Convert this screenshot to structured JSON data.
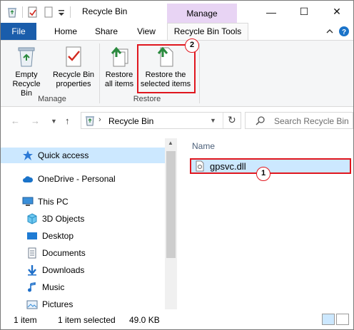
{
  "window": {
    "title": "Recycle Bin",
    "context_tab_group": "Manage",
    "minimize_glyph": "—",
    "maximize_glyph": "☐",
    "close_glyph": "✕"
  },
  "tabs": {
    "file": "File",
    "home": "Home",
    "share": "Share",
    "view": "View",
    "recycle_bin_tools": "Recycle Bin Tools"
  },
  "ribbon": {
    "empty_recycle_bin": "Empty\nRecycle Bin",
    "recycle_bin_properties": "Recycle Bin\nproperties",
    "manage_group": "Manage",
    "restore_all_items": "Restore\nall items",
    "restore_selected_items": "Restore the\nselected items",
    "restore_group": "Restore"
  },
  "navigation": {
    "address_path": "Recycle Bin",
    "search_placeholder": "Search Recycle Bin"
  },
  "nav_pane": {
    "items": [
      {
        "label": "Quick access",
        "icon": "star-icon"
      },
      {
        "label": "OneDrive - Personal",
        "icon": "cloud-icon"
      },
      {
        "label": "This PC",
        "icon": "pc-icon"
      },
      {
        "label": "3D Objects",
        "icon": "cube-icon"
      },
      {
        "label": "Desktop",
        "icon": "desktop-icon"
      },
      {
        "label": "Documents",
        "icon": "documents-icon"
      },
      {
        "label": "Downloads",
        "icon": "downloads-icon"
      },
      {
        "label": "Music",
        "icon": "music-icon"
      },
      {
        "label": "Pictures",
        "icon": "pictures-icon"
      }
    ]
  },
  "content": {
    "column_name": "Name",
    "file_name": "gpsvc.dll"
  },
  "annotations": {
    "step1": "1",
    "step2": "2"
  },
  "status_bar": {
    "item_count": "1 item",
    "selection": "1 item selected",
    "size": "49.0 KB"
  },
  "colors": {
    "file_tab": "#1a5dab",
    "context_tab": "#e8d4f4",
    "selection": "#cce8ff",
    "highlight_red": "#e0161e"
  }
}
